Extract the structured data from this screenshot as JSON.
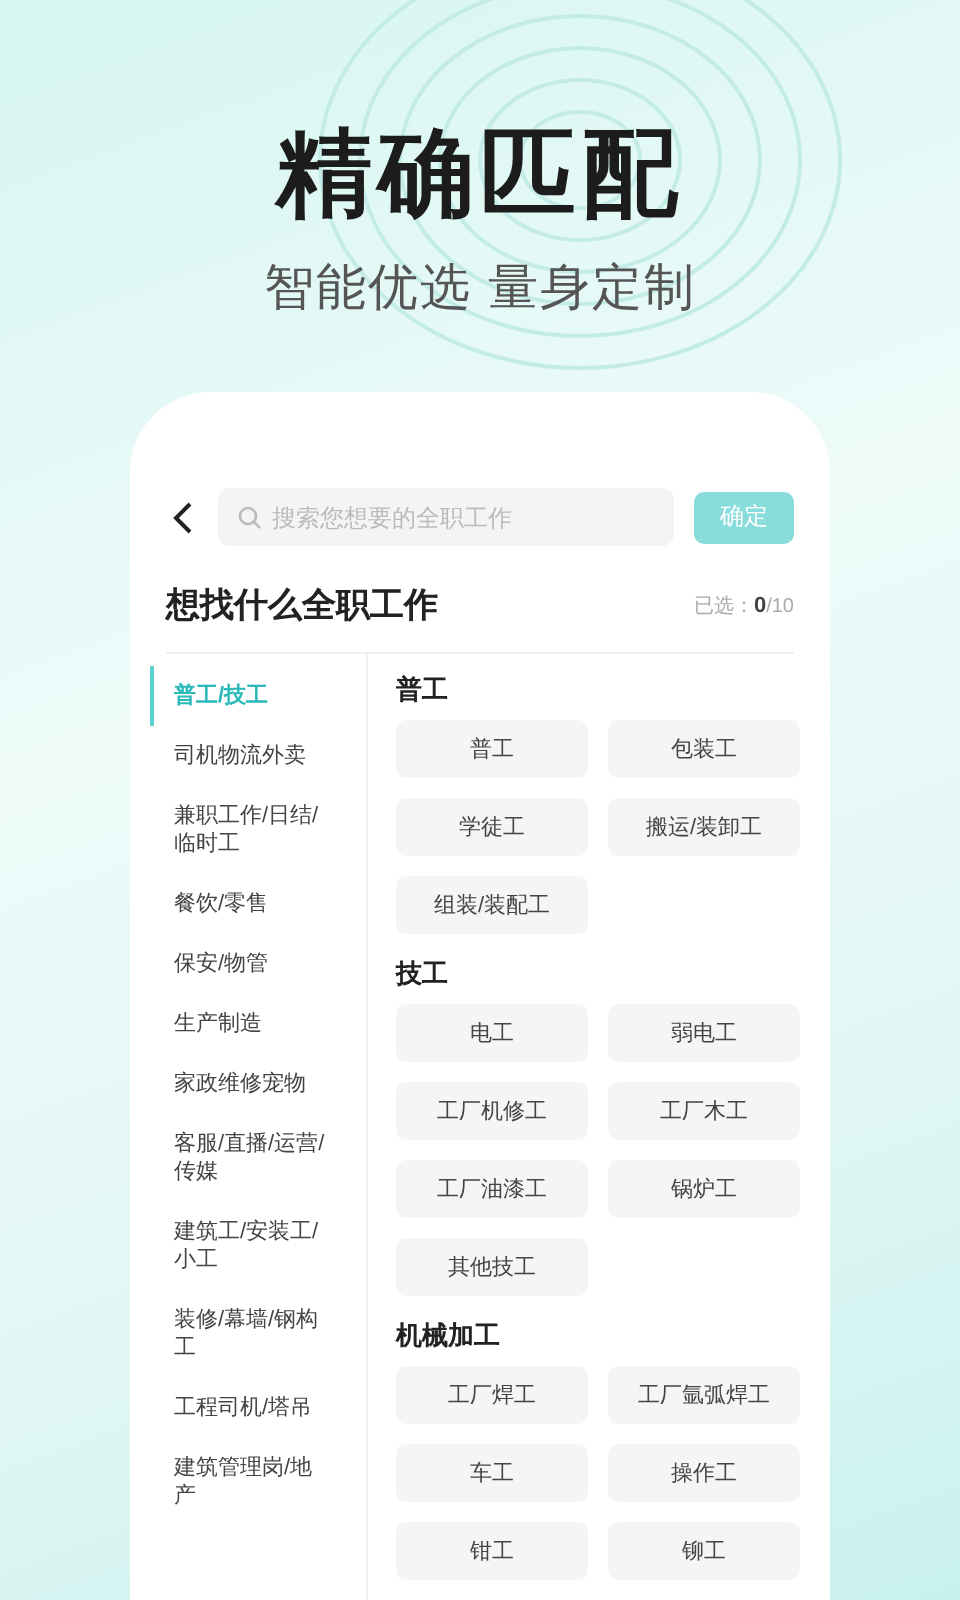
{
  "headline": "精确匹配",
  "subtitle": "智能优选 量身定制",
  "search": {
    "placeholder": "搜索您想要的全职工作"
  },
  "confirm_button": "确定",
  "title": "想找什么全职工作",
  "selected_count": {
    "label": "已选：",
    "count": "0",
    "total": "/10"
  },
  "categories": [
    {
      "label": "普工/技工",
      "selected": true
    },
    {
      "label": "司机物流外卖",
      "selected": false
    },
    {
      "label": "兼职工作/日结/临时工",
      "selected": false
    },
    {
      "label": "餐饮/零售",
      "selected": false
    },
    {
      "label": "保安/物管",
      "selected": false
    },
    {
      "label": "生产制造",
      "selected": false
    },
    {
      "label": "家政维修宠物",
      "selected": false
    },
    {
      "label": "客服/直播/运营/传媒",
      "selected": false
    },
    {
      "label": "建筑工/安装工/小工",
      "selected": false
    },
    {
      "label": "装修/幕墙/钢构工",
      "selected": false
    },
    {
      "label": "工程司机/塔吊",
      "selected": false
    },
    {
      "label": "建筑管理岗/地产",
      "selected": false
    }
  ],
  "sections": [
    {
      "title": "普工",
      "jobs": [
        "普工",
        "包装工",
        "学徒工",
        "搬运/装卸工",
        "组装/装配工"
      ]
    },
    {
      "title": "技工",
      "jobs": [
        "电工",
        "弱电工",
        "工厂机修工",
        "工厂木工",
        "工厂油漆工",
        "锅炉工",
        "其他技工"
      ]
    },
    {
      "title": "机械加工",
      "jobs": [
        "工厂焊工",
        "工厂氩弧焊工",
        "车工",
        "操作工",
        "钳工",
        "铆工"
      ]
    }
  ]
}
